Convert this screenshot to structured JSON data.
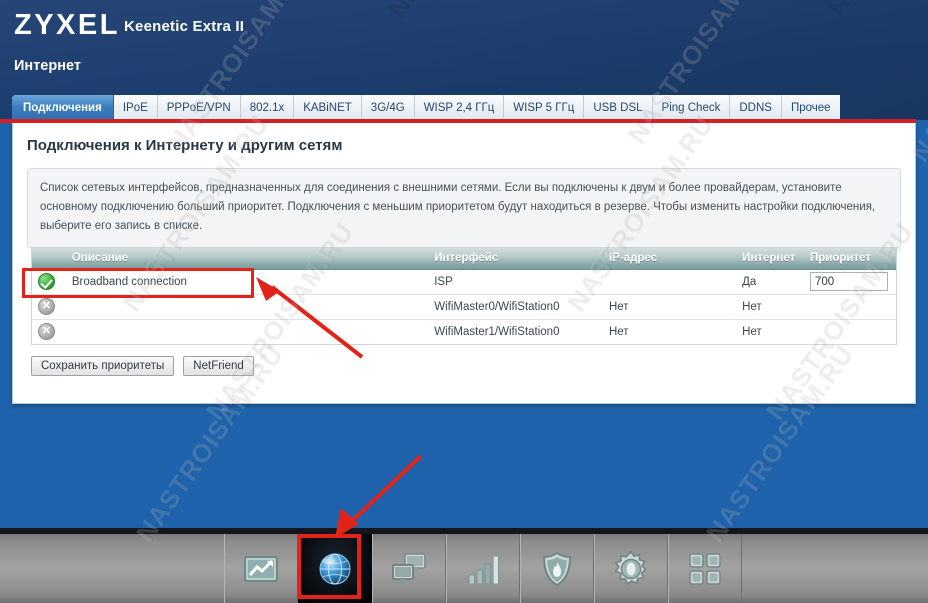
{
  "header": {
    "brand": "ZYXEL",
    "model": "Keenetic Extra II",
    "section": "Интернет"
  },
  "tabs": [
    {
      "label": "Подключения",
      "active": true
    },
    {
      "label": "IPoE",
      "active": false
    },
    {
      "label": "PPPoE/VPN",
      "active": false
    },
    {
      "label": "802.1x",
      "active": false
    },
    {
      "label": "KABiNET",
      "active": false
    },
    {
      "label": "3G/4G",
      "active": false
    },
    {
      "label": "WISP 2,4 ГГц",
      "active": false
    },
    {
      "label": "WISP 5 ГГц",
      "active": false
    },
    {
      "label": "USB DSL",
      "active": false
    },
    {
      "label": "Ping Check",
      "active": false
    },
    {
      "label": "DDNS",
      "active": false
    },
    {
      "label": "Прочее",
      "active": false
    }
  ],
  "panel": {
    "heading": "Подключения к Интернету и другим сетям",
    "info": "Список сетевых интерфейсов, предназначенных для соединения с внешними сетями. Если вы подключены к двум и более провайдерам, установите основному подключению больший приоритет. Подключения с меньшим приоритетом будут находиться в резерве. Чтобы изменить настройки подключения, выберите его запись в списке."
  },
  "table": {
    "columns": [
      "",
      "Описание",
      "Интерфейс",
      "IP-адрес",
      "Интернет",
      "Приоритет"
    ],
    "rows": [
      {
        "status": "ok",
        "status_glyph": "",
        "description": "Broadband connection",
        "interface": "ISP",
        "ip": "",
        "internet": "Да",
        "priority": "700",
        "has_priority_input": true
      },
      {
        "status": "off",
        "status_glyph": "✕",
        "description": "",
        "interface": "WifiMaster0/WifiStation0",
        "ip": "Нет",
        "internet": "Нет",
        "priority": "",
        "has_priority_input": false
      },
      {
        "status": "off",
        "status_glyph": "✕",
        "description": "",
        "interface": "WifiMaster1/WifiStation0",
        "ip": "Нет",
        "internet": "Нет",
        "priority": "",
        "has_priority_input": false
      }
    ]
  },
  "buttons": {
    "save_priorities": "Сохранить приоритеты",
    "netfriend": "NetFriend"
  },
  "taskbar": {
    "items": [
      {
        "icon": "monitor-chart-icon",
        "active": false
      },
      {
        "icon": "globe-internet-icon",
        "active": true
      },
      {
        "icon": "home-network-icon",
        "active": false
      },
      {
        "icon": "wifi-signal-bars-icon",
        "active": false
      },
      {
        "icon": "firewall-shield-icon",
        "active": false
      },
      {
        "icon": "system-gear-icon",
        "active": false
      },
      {
        "icon": "applications-grid-icon",
        "active": false
      }
    ]
  },
  "watermarks": {
    "text": "NASTROISAM.RU"
  },
  "colors": {
    "header_navy": "#1d3f72",
    "page_blue": "#1e63ab",
    "annotation_red": "#e2231a",
    "active_tab_blue": "#3c7fc0",
    "status_ok_green": "#39ad3c",
    "table_header_teal": "#8aa9a9"
  }
}
